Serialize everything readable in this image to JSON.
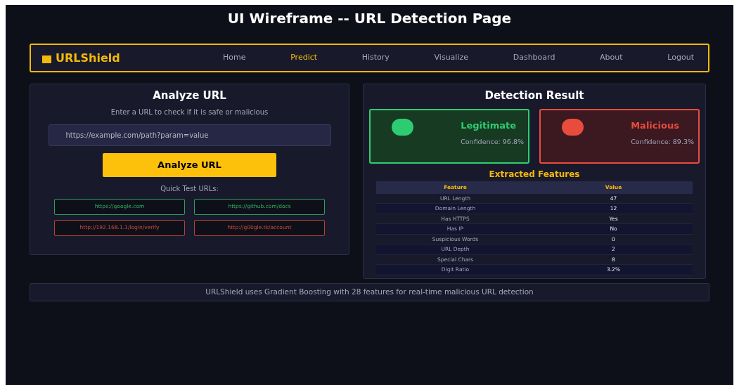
{
  "title": "UI Wireframe -- URL Detection Page",
  "brand": "URLShield",
  "nav": [
    {
      "label": "Home",
      "selected": false
    },
    {
      "label": "Predict",
      "selected": true
    },
    {
      "label": "History",
      "selected": false
    },
    {
      "label": "Visualize",
      "selected": false
    },
    {
      "label": "Dashboard",
      "selected": false
    },
    {
      "label": "About",
      "selected": false
    },
    {
      "label": "Logout",
      "selected": false
    }
  ],
  "analyze": {
    "title": "Analyze URL",
    "subtitle": "Enter a URL to check if it is safe or malicious",
    "input_value": "https://example.com/path?param=value",
    "button": "Analyze URL",
    "quick_title": "Quick Test URLs:",
    "quick_urls": [
      {
        "label": "https://google.com",
        "kind": "safe"
      },
      {
        "label": "https://github.com/docs",
        "kind": "safe"
      },
      {
        "label": "http://192.168.1.1/login/verify",
        "kind": "malicious"
      },
      {
        "label": "http://g00gle.tk/account",
        "kind": "malicious"
      }
    ]
  },
  "result": {
    "title": "Detection Result",
    "cards": [
      {
        "kind": "safe",
        "label": "Legitimate",
        "confidence": "Confidence: 96.8%"
      },
      {
        "kind": "malicious",
        "label": "Malicious",
        "confidence": "Confidence: 89.3%"
      }
    ],
    "features_title": "Extracted Features",
    "table": {
      "columns": [
        "Feature",
        "Value"
      ],
      "rows": [
        [
          "URL Length",
          "47"
        ],
        [
          "Domain Length",
          "12"
        ],
        [
          "Has HTTPS",
          "Yes"
        ],
        [
          "Has IP",
          "No"
        ],
        [
          "Suspicious Words",
          "0"
        ],
        [
          "URL Depth",
          "2"
        ],
        [
          "Special Chars",
          "8"
        ],
        [
          "Digit Ratio",
          "3.2%"
        ]
      ]
    }
  },
  "footer": "URLShield uses Gradient Boosting with 28 features for real-time malicious URL detection"
}
